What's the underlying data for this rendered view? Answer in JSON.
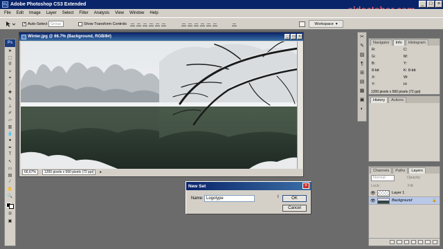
{
  "app": {
    "title": "Adobe Photoshop CS3 Extended",
    "watermark": "oldoctober.com",
    "logo": "Ps",
    "window_controls": [
      "_",
      "□",
      "×"
    ]
  },
  "menu": {
    "items": [
      "File",
      "Edit",
      "Image",
      "Layer",
      "Select",
      "Filter",
      "Analysis",
      "View",
      "Window",
      "Help"
    ]
  },
  "options": {
    "auto_select_label": "Auto-Select",
    "auto_select_value": "Group",
    "transform_label": "Show Transform Controls",
    "workspace_label": "Workspace"
  },
  "document": {
    "title": "Winter.jpg @ 66.7% (Background, RGB/8#)",
    "zoom": "66,67%",
    "info": "1200 pixels x 560 pixels (72 ppi)"
  },
  "dialog": {
    "title": "New Set",
    "name_label": "Name:",
    "name_value": "Logotype",
    "ok_label": "OK",
    "cancel_label": "Cancel",
    "close": "×"
  },
  "panels": {
    "navigator_tabs": [
      "Navigator",
      "Info",
      "Histogram"
    ],
    "info": {
      "r": "R:",
      "g": "G:",
      "b": "B:",
      "bits": "8-bit",
      "c": "C:",
      "m": "M:",
      "y": "Y:",
      "k": "K:",
      "bits2": "8-bit",
      "x": "X:",
      "yy": "Y:",
      "w": "W:",
      "h": "H:"
    },
    "doc_info": "1200 pixels x 560 pixels (72 ppi)",
    "history_tabs": [
      "History",
      "Actions"
    ],
    "layers_tabs": [
      "Channels",
      "Paths",
      "Layers"
    ],
    "blend_mode": "Normal",
    "opacity_label": "Opacity:",
    "lock_label": "Lock:",
    "fill_label": "Fill:",
    "layers": [
      {
        "name": "Layer 1",
        "italic": false
      },
      {
        "name": "Background",
        "italic": true
      }
    ]
  },
  "tools": [
    "move",
    "marquee",
    "lasso",
    "magic-wand",
    "crop",
    "slice",
    "healing",
    "brush",
    "stamp",
    "history-brush",
    "eraser",
    "gradient",
    "blur",
    "dodge",
    "pen",
    "type",
    "path-select",
    "shape",
    "notes",
    "eyedropper",
    "hand",
    "zoom"
  ]
}
